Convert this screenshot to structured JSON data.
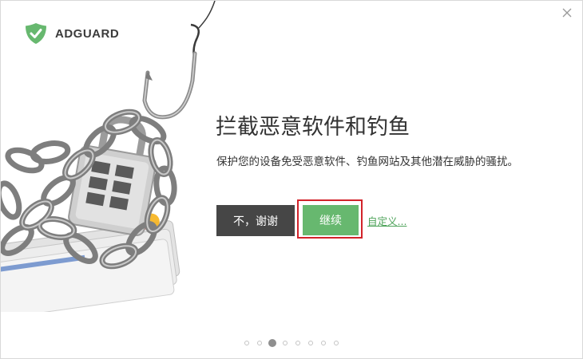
{
  "app": {
    "brand_name": "ADGUARD",
    "logo_icon": "adguard-shield-icon",
    "accent_color": "#67b86f"
  },
  "window": {
    "close_icon": "close-icon"
  },
  "slide": {
    "headline": "拦截恶意软件和钓鱼",
    "description": "保护您的设备免受恶意软件、钓鱼网站及其他潜在威胁的骚扰。",
    "illustration": "fishing-hook-padlock-chain-credit-cards-illustration"
  },
  "actions": {
    "decline_label": "不，谢谢",
    "continue_label": "继续",
    "custom_label": "自定义..."
  },
  "pager": {
    "total_pages": 8,
    "current_page": 3
  }
}
